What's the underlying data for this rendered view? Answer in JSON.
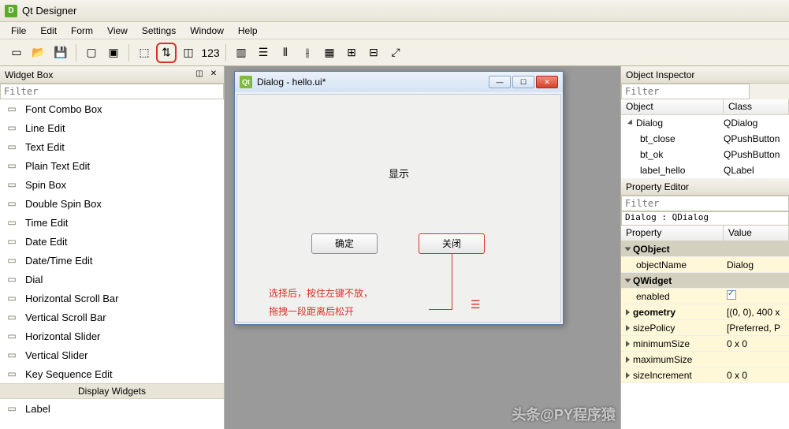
{
  "app": {
    "title": "Qt Designer",
    "icon_letter": "D"
  },
  "menu": [
    "File",
    "Edit",
    "Form",
    "View",
    "Settings",
    "Window",
    "Help"
  ],
  "toolbar_icons": [
    {
      "name": "new-form-icon",
      "glyph": "▭"
    },
    {
      "name": "open-icon",
      "glyph": "📂"
    },
    {
      "name": "save-icon",
      "glyph": "💾"
    },
    {
      "name": "sep"
    },
    {
      "name": "send-back-icon",
      "glyph": "▢"
    },
    {
      "name": "bring-front-icon",
      "glyph": "▣"
    },
    {
      "name": "sep"
    },
    {
      "name": "edit-widgets-icon",
      "glyph": "⬚"
    },
    {
      "name": "edit-signals-icon",
      "glyph": "⇅",
      "highlight": true
    },
    {
      "name": "edit-buddies-icon",
      "glyph": "◫"
    },
    {
      "name": "edit-tab-order-icon",
      "glyph": "123"
    },
    {
      "name": "sep"
    },
    {
      "name": "layout-h-icon",
      "glyph": "▥"
    },
    {
      "name": "layout-v-icon",
      "glyph": "☰"
    },
    {
      "name": "layout-h-split-icon",
      "glyph": "⫴"
    },
    {
      "name": "layout-v-split-icon",
      "glyph": "⫲"
    },
    {
      "name": "layout-grid-icon",
      "glyph": "▦"
    },
    {
      "name": "layout-form-icon",
      "glyph": "⊞"
    },
    {
      "name": "break-layout-icon",
      "glyph": "⊟"
    },
    {
      "name": "adjust-size-icon",
      "glyph": "⤢"
    }
  ],
  "widgetbox": {
    "title": "Widget Box",
    "filter_placeholder": "Filter",
    "items": [
      {
        "icon": "font-icon",
        "label": "Font Combo Box"
      },
      {
        "icon": "line-edit-icon",
        "label": "Line Edit"
      },
      {
        "icon": "text-edit-icon",
        "label": "Text Edit"
      },
      {
        "icon": "plain-text-icon",
        "label": "Plain Text Edit"
      },
      {
        "icon": "spin-icon",
        "label": "Spin Box"
      },
      {
        "icon": "double-spin-icon",
        "label": "Double Spin Box"
      },
      {
        "icon": "time-icon",
        "label": "Time Edit"
      },
      {
        "icon": "date-icon",
        "label": "Date Edit"
      },
      {
        "icon": "datetime-icon",
        "label": "Date/Time Edit"
      },
      {
        "icon": "dial-icon",
        "label": "Dial"
      },
      {
        "icon": "hscroll-icon",
        "label": "Horizontal Scroll Bar"
      },
      {
        "icon": "vscroll-icon",
        "label": "Vertical Scroll Bar"
      },
      {
        "icon": "hslider-icon",
        "label": "Horizontal Slider"
      },
      {
        "icon": "vslider-icon",
        "label": "Vertical Slider"
      },
      {
        "icon": "key-seq-icon",
        "label": "Key Sequence Edit"
      }
    ],
    "category": "Display Widgets",
    "items2": [
      {
        "icon": "label-icon",
        "label": "Label"
      }
    ]
  },
  "dialog": {
    "title": "Dialog - hello.ui*",
    "icon_letter": "Qt",
    "label_hello": "显示",
    "btn_ok": "确定",
    "btn_close": "关闭",
    "annotation_l1": "选择后，按住左键不放，",
    "annotation_l2": "拖拽一段距离后松开",
    "anno_glyph": "☰"
  },
  "inspector": {
    "title": "Object Inspector",
    "filter_placeholder": "Filter",
    "col_object": "Object",
    "col_class": "Class",
    "rows": [
      {
        "indent": 0,
        "expand": true,
        "icon": "dialog-icon",
        "object": "Dialog",
        "class": "QDialog"
      },
      {
        "indent": 1,
        "icon": "button-icon",
        "object": "bt_close",
        "class": "QPushButton"
      },
      {
        "indent": 1,
        "icon": "button-icon",
        "object": "bt_ok",
        "class": "QPushButton"
      },
      {
        "indent": 1,
        "icon": "label-icon",
        "object": "label_hello",
        "class": "QLabel"
      }
    ]
  },
  "propeditor": {
    "title": "Property Editor",
    "filter_placeholder": "Filter",
    "crumb": "Dialog : QDialog",
    "col_prop": "Property",
    "col_val": "Value",
    "rows": [
      {
        "type": "group",
        "label": "QObject"
      },
      {
        "type": "prop",
        "yel": true,
        "label": "objectName",
        "value": "Dialog"
      },
      {
        "type": "group",
        "label": "QWidget"
      },
      {
        "type": "prop",
        "yel": true,
        "label": "enabled",
        "value": "__check__"
      },
      {
        "type": "prop",
        "yel": true,
        "expand": true,
        "bold": true,
        "label": "geometry",
        "value": "[(0, 0), 400 x"
      },
      {
        "type": "prop",
        "yel": true,
        "expand": true,
        "label": "sizePolicy",
        "value": "[Preferred, P"
      },
      {
        "type": "prop",
        "yel": true,
        "expand": true,
        "label": "minimumSize",
        "value": "0 x 0"
      },
      {
        "type": "prop",
        "yel": true,
        "expand": true,
        "label": "maximumSize",
        "value": ""
      },
      {
        "type": "prop",
        "yel": true,
        "expand": true,
        "label": "sizeIncrement",
        "value": "0 x 0"
      }
    ]
  },
  "watermark": "头条@PY程序猿"
}
